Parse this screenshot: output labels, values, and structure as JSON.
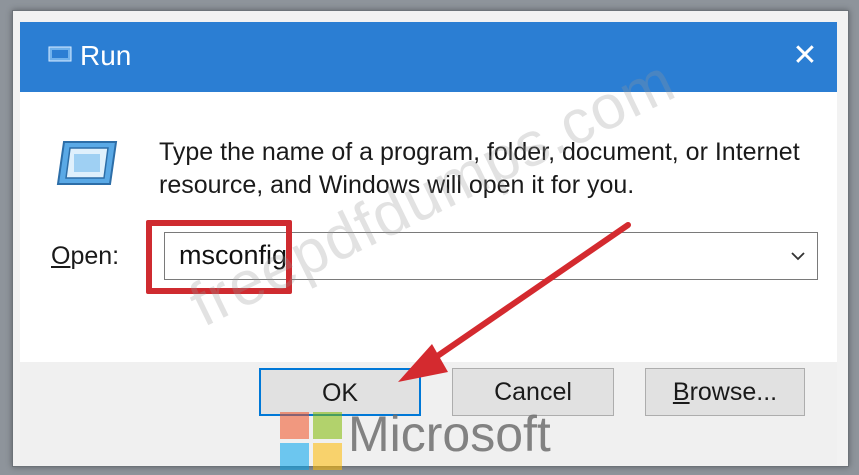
{
  "window": {
    "title": "Run",
    "close_glyph": "✕"
  },
  "dialog": {
    "description": "Type the name of a program, folder, document, or Internet resource, and Windows will open it for you.",
    "open_label_prefix": "",
    "open_label_mnemonic": "O",
    "open_label_rest": "pen:",
    "input_value": "msconfig"
  },
  "buttons": {
    "ok": "OK",
    "cancel": "Cancel",
    "browse_mnemonic": "B",
    "browse_rest": "rowse..."
  },
  "overlay": {
    "watermark": "freepdfdumps.com",
    "logo_text": "Microsoft",
    "highlight_color": "#cf2b30",
    "arrow_color": "#d42a2f"
  },
  "colors": {
    "titlebar": "#2b7ed3",
    "accent": "#0078d7"
  },
  "icons": [
    "run-icon",
    "close-icon",
    "dropdown-chevron-icon",
    "microsoft-logo"
  ]
}
